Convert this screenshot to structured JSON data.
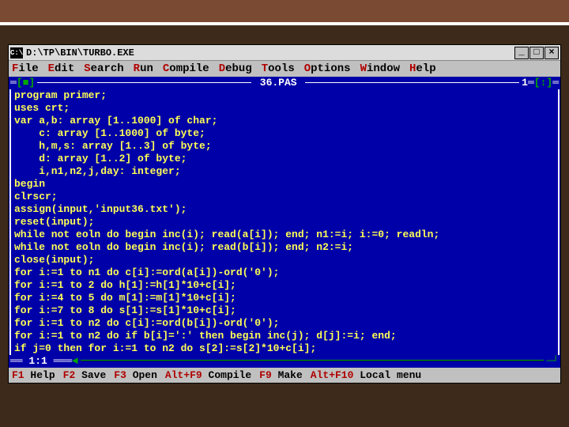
{
  "window": {
    "icon_text": "C:\\",
    "title": "D:\\TP\\BIN\\TURBO.EXE",
    "btn_min": "_",
    "btn_max": "□",
    "btn_close": "×"
  },
  "menu": {
    "file": "File",
    "edit": "Edit",
    "search": "Search",
    "run": "Run",
    "compile": "Compile",
    "debug": "Debug",
    "tools": "Tools",
    "options": "Options",
    "window": "Window",
    "help": "Help"
  },
  "editor": {
    "close_glyph": "[■]",
    "filename": "36.PAS",
    "window_num": "1",
    "scroll_glyph": "[↕]",
    "code": "program primer;\nuses crt;\nvar a,b: array [1..1000] of char;\n    c: array [1..1000] of byte;\n    h,m,s: array [1..3] of byte;\n    d: array [1..2] of byte;\n    i,n1,n2,j,day: integer;\nbegin\nclrscr;\nassign(input,'input36.txt');\nreset(input);\nwhile not eoln do begin inc(i); read(a[i]); end; n1:=i; i:=0; readln;\nwhile not eoln do begin inc(i); read(b[i]); end; n2:=i;\nclose(input);\nfor i:=1 to n1 do c[i]:=ord(a[i])-ord('0');\nfor i:=1 to 2 do h[1]:=h[1]*10+c[i];\nfor i:=4 to 5 do m[1]:=m[1]*10+c[i];\nfor i:=7 to 8 do s[1]:=s[1]*10+c[i];\nfor i:=1 to n2 do c[i]:=ord(b[i])-ord('0');\nfor i:=1 to n2 do if b[i]=':' then begin inc(j); d[j]:=i; end;\nif j=0 then for i:=1 to n2 do s[2]:=s[2]*10+c[i];",
    "cursor_pos": "1:1",
    "left_arrow": "◄",
    "right_arrow": "─┘"
  },
  "status": {
    "f1": "F1",
    "f1l": "Help",
    "f2": "F2",
    "f2l": "Save",
    "f3": "F3",
    "f3l": "Open",
    "af9": "Alt+F9",
    "af9l": "Compile",
    "f9": "F9",
    "f9l": "Make",
    "af10": "Alt+F10",
    "af10l": "Local menu"
  }
}
